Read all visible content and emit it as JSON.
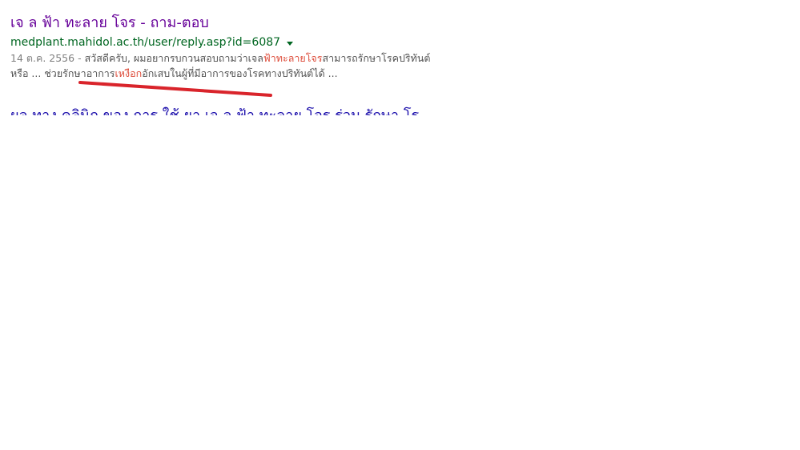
{
  "result": {
    "title": "เจ ล ฟ้า ทะลาย โจร - ถาม-ตอบ",
    "url": "medplant.mahidol.ac.th/user/reply.asp?id=6087",
    "snippet_line1": {
      "date": "14 ต.ค. 2556",
      "sep": " - ",
      "text_a": "สวัสดีครับ, ผมอยากรบกวนสอบถามว่าเจล",
      "hl_a": "ฟ้าทะลายโจร",
      "text_b": "สามารถรักษาโรคปริทันต์"
    },
    "snippet_line2": {
      "text_a": "หรือ ... ช่วยรักษาอาการ",
      "hl_a": "เหงือก",
      "text_b": "อักเสบในผู้ที่มีอาการของโรคทางปริทันต์ได้ ..."
    }
  },
  "next_result": {
    "title": "ผล ทาง คลินิก ของ การ ใช้ ยา เจ ล ฟ้า ทะลาย โจร ร่วม รักษา โร"
  },
  "colors": {
    "visited_title": "#660099",
    "link_title": "#1a0dab",
    "url": "#006621",
    "snippet": "#545454",
    "highlight": "#dd4b39",
    "annotation": "#d9242b"
  },
  "icons": {
    "url_menu": "dropdown-arrow-icon"
  }
}
